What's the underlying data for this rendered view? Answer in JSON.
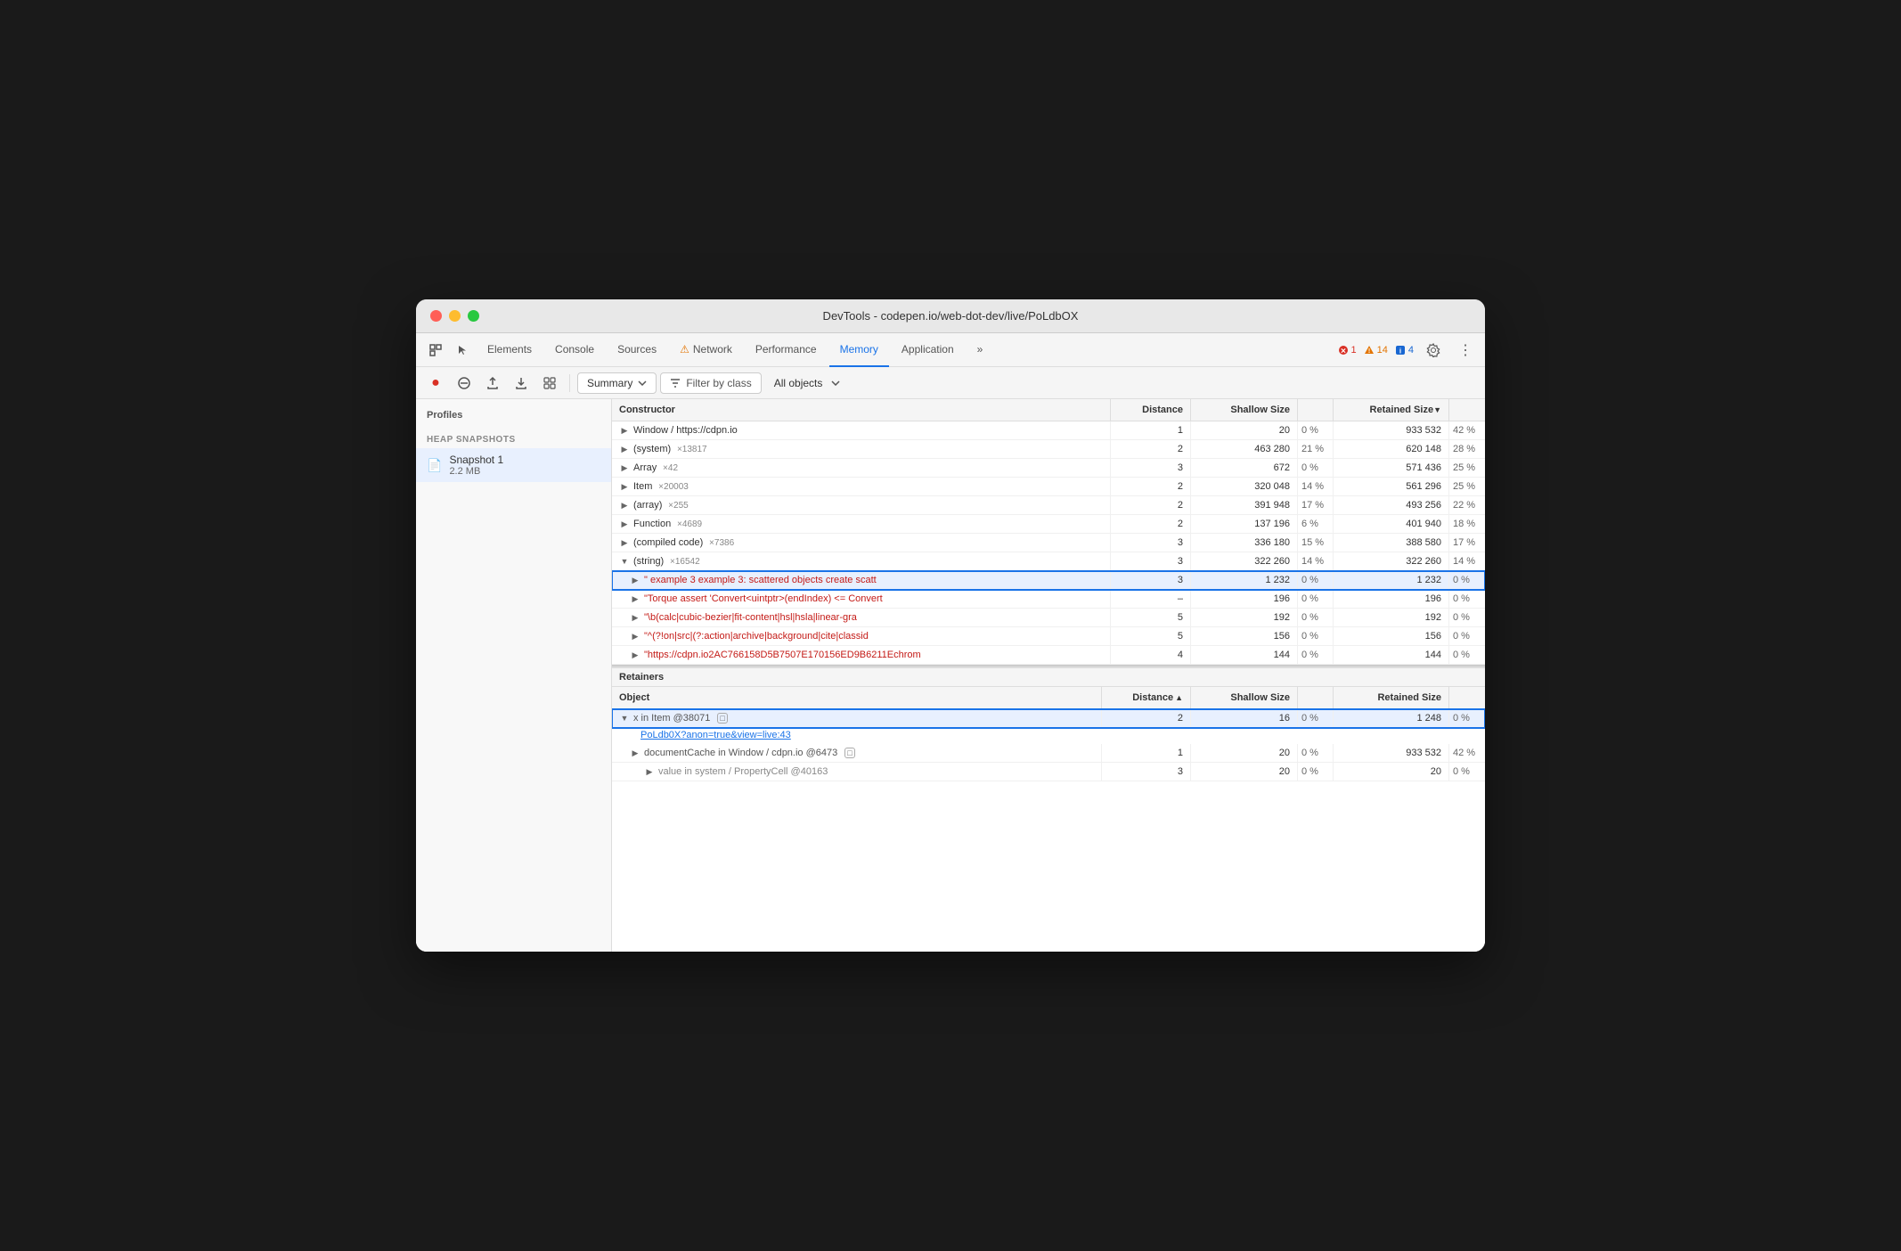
{
  "window": {
    "title": "DevTools - codepen.io/web-dot-dev/live/PoLdbOX"
  },
  "nav": {
    "tabs": [
      {
        "id": "elements",
        "label": "Elements",
        "active": false
      },
      {
        "id": "console",
        "label": "Console",
        "active": false
      },
      {
        "id": "sources",
        "label": "Sources",
        "active": false
      },
      {
        "id": "network",
        "label": "Network",
        "active": false,
        "warning": true
      },
      {
        "id": "performance",
        "label": "Performance",
        "active": false
      },
      {
        "id": "memory",
        "label": "Memory",
        "active": true
      },
      {
        "id": "application",
        "label": "Application",
        "active": false
      }
    ],
    "more_label": "»",
    "errors": "1",
    "warnings": "14",
    "info": "4"
  },
  "toolbar": {
    "record_label": "●",
    "clear_label": "⊘",
    "upload_label": "↑",
    "download_label": "↓",
    "collect_label": "⚙",
    "summary_label": "Summary",
    "filter_label": "Filter by class",
    "all_objects_label": "All objects"
  },
  "sidebar": {
    "title": "Profiles",
    "section_label": "HEAP SNAPSHOTS",
    "snapshot": {
      "name": "Snapshot 1",
      "size": "2.2 MB"
    }
  },
  "table": {
    "headers": [
      {
        "id": "constructor",
        "label": "Constructor"
      },
      {
        "id": "distance",
        "label": "Distance"
      },
      {
        "id": "shallow_size",
        "label": "Shallow Size"
      },
      {
        "id": "shallow_pct",
        "label": ""
      },
      {
        "id": "retained_size",
        "label": "Retained Size"
      },
      {
        "id": "retained_pct",
        "label": ""
      }
    ],
    "rows": [
      {
        "constructor": "Window / https://cdpn.io",
        "distance": "1",
        "shallow_size": "20",
        "shallow_pct": "0 %",
        "retained_size": "933 532",
        "retained_pct": "42 %",
        "expandable": true,
        "indent": 0
      },
      {
        "constructor": "(system)",
        "count": "×13817",
        "distance": "2",
        "shallow_size": "463 280",
        "shallow_pct": "21 %",
        "retained_size": "620 148",
        "retained_pct": "28 %",
        "expandable": true,
        "indent": 0
      },
      {
        "constructor": "Array",
        "count": "×42",
        "distance": "3",
        "shallow_size": "672",
        "shallow_pct": "0 %",
        "retained_size": "571 436",
        "retained_pct": "25 %",
        "expandable": true,
        "indent": 0
      },
      {
        "constructor": "Item",
        "count": "×20003",
        "distance": "2",
        "shallow_size": "320 048",
        "shallow_pct": "14 %",
        "retained_size": "561 296",
        "retained_pct": "25 %",
        "expandable": true,
        "indent": 0
      },
      {
        "constructor": "(array)",
        "count": "×255",
        "distance": "2",
        "shallow_size": "391 948",
        "shallow_pct": "17 %",
        "retained_size": "493 256",
        "retained_pct": "22 %",
        "expandable": true,
        "indent": 0
      },
      {
        "constructor": "Function",
        "count": "×4689",
        "distance": "2",
        "shallow_size": "137 196",
        "shallow_pct": "6 %",
        "retained_size": "401 940",
        "retained_pct": "18 %",
        "expandable": true,
        "indent": 0
      },
      {
        "constructor": "(compiled code)",
        "count": "×7386",
        "distance": "3",
        "shallow_size": "336 180",
        "shallow_pct": "15 %",
        "retained_size": "388 580",
        "retained_pct": "17 %",
        "expandable": true,
        "indent": 0
      },
      {
        "constructor": "(string)",
        "count": "×16542",
        "distance": "3",
        "shallow_size": "322 260",
        "shallow_pct": "14 %",
        "retained_size": "322 260",
        "retained_pct": "14 %",
        "expandable": true,
        "expanded": true,
        "indent": 0
      },
      {
        "constructor": "\" example 3 example 3: scattered objects create scatt",
        "distance": "3",
        "shallow_size": "1 232",
        "shallow_pct": "0 %",
        "retained_size": "1 232",
        "retained_pct": "0 %",
        "expandable": true,
        "indent": 1,
        "string": true,
        "selected": true
      },
      {
        "constructor": "\"Torque assert 'Convert<uintptr>(endIndex) <= Convert",
        "distance": "–",
        "shallow_size": "196",
        "shallow_pct": "0 %",
        "retained_size": "196",
        "retained_pct": "0 %",
        "expandable": true,
        "indent": 1,
        "string": true
      },
      {
        "constructor": "\"\\b(calc|cubic-bezier|fit-content|hsl|hsla|linear-gra",
        "distance": "5",
        "shallow_size": "192",
        "shallow_pct": "0 %",
        "retained_size": "192",
        "retained_pct": "0 %",
        "expandable": true,
        "indent": 1,
        "string": true
      },
      {
        "constructor": "\"^(?!on|src|(?:action|archive|background|cite|classid",
        "distance": "5",
        "shallow_size": "156",
        "shallow_pct": "0 %",
        "retained_size": "156",
        "retained_pct": "0 %",
        "expandable": true,
        "indent": 1,
        "string": true
      },
      {
        "constructor": "\"https://cdpn.io2AC766158D5B7507E170156ED9B6211Echrom",
        "distance": "4",
        "shallow_size": "144",
        "shallow_pct": "0 %",
        "retained_size": "144",
        "retained_pct": "0 %",
        "expandable": true,
        "indent": 1,
        "string": true
      }
    ]
  },
  "retainers": {
    "title": "Retainers",
    "headers": [
      {
        "id": "object",
        "label": "Object"
      },
      {
        "id": "distance",
        "label": "Distance"
      },
      {
        "id": "shallow_size",
        "label": "Shallow Size"
      },
      {
        "id": "shallow_pct",
        "label": ""
      },
      {
        "id": "retained_size",
        "label": "Retained Size"
      },
      {
        "id": "retained_pct",
        "label": ""
      }
    ],
    "rows": [
      {
        "object": "x in Item @38071",
        "tag": "□",
        "link": "PoLdb0X?anon=true&view=live:43",
        "distance": "2",
        "shallow_size": "16",
        "shallow_pct": "0 %",
        "retained_size": "1 248",
        "retained_pct": "0 %",
        "expandable": true,
        "selected": true,
        "indent": 0
      },
      {
        "object": "documentCache in Window / cdpn.io @6473",
        "tag": "□",
        "distance": "1",
        "shallow_size": "20",
        "shallow_pct": "0 %",
        "retained_size": "933 532",
        "retained_pct": "42 %",
        "expandable": true,
        "indent": 1
      },
      {
        "object": "value in system / PropertyCell @40163",
        "distance": "3",
        "shallow_size": "20",
        "shallow_pct": "0 %",
        "retained_size": "20",
        "retained_pct": "0 %",
        "expandable": true,
        "indent": 2
      }
    ]
  }
}
